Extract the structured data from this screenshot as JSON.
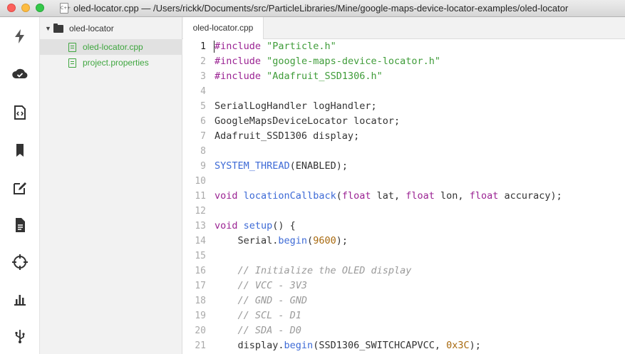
{
  "window": {
    "title": "oled-locator.cpp — /Users/rickk/Documents/src/ParticleLibraries/Mine/google-maps-device-locator-examples/oled-locator",
    "file_icon_text": "C++"
  },
  "activity_bar": [
    {
      "name": "flash",
      "icon": "lightning-icon"
    },
    {
      "name": "cloud",
      "icon": "cloud-check-icon"
    },
    {
      "name": "code",
      "icon": "code-file-icon"
    },
    {
      "name": "libraries",
      "icon": "bookmark-icon"
    },
    {
      "name": "edit",
      "icon": "edit-icon"
    },
    {
      "name": "docs",
      "icon": "document-icon"
    },
    {
      "name": "devices",
      "icon": "crosshair-icon"
    },
    {
      "name": "console",
      "icon": "bar-chart-icon"
    },
    {
      "name": "usb",
      "icon": "usb-icon"
    }
  ],
  "tree": {
    "root": "oled-locator",
    "files": [
      {
        "name": "oled-locator.cpp",
        "selected": true
      },
      {
        "name": "project.properties",
        "selected": false
      }
    ]
  },
  "tabs": [
    {
      "label": "oled-locator.cpp",
      "active": true
    }
  ],
  "editor": {
    "active_line": 1,
    "lines": [
      {
        "n": "1",
        "tokens": [
          [
            "kw",
            "#include"
          ],
          [
            "",
            " "
          ],
          [
            "str",
            "\"Particle.h\""
          ]
        ]
      },
      {
        "n": "2",
        "tokens": [
          [
            "kw",
            "#include"
          ],
          [
            "",
            " "
          ],
          [
            "str",
            "\"google-maps-device-locator.h\""
          ]
        ]
      },
      {
        "n": "3",
        "tokens": [
          [
            "kw",
            "#include"
          ],
          [
            "",
            " "
          ],
          [
            "str",
            "\"Adafruit_SSD1306.h\""
          ]
        ]
      },
      {
        "n": "4",
        "tokens": []
      },
      {
        "n": "5",
        "tokens": [
          [
            "",
            "SerialLogHandler logHandler;"
          ]
        ]
      },
      {
        "n": "6",
        "tokens": [
          [
            "",
            "GoogleMapsDeviceLocator locator;"
          ]
        ]
      },
      {
        "n": "7",
        "tokens": [
          [
            "",
            "Adafruit_SSD1306 display;"
          ]
        ]
      },
      {
        "n": "8",
        "tokens": []
      },
      {
        "n": "9",
        "tokens": [
          [
            "fn",
            "SYSTEM_THREAD"
          ],
          [
            "",
            "(ENABLED);"
          ]
        ]
      },
      {
        "n": "10",
        "tokens": []
      },
      {
        "n": "11",
        "tokens": [
          [
            "kw",
            "void"
          ],
          [
            "",
            " "
          ],
          [
            "fn",
            "locationCallback"
          ],
          [
            "",
            "("
          ],
          [
            "kw",
            "float"
          ],
          [
            "",
            " lat, "
          ],
          [
            "kw",
            "float"
          ],
          [
            "",
            " lon, "
          ],
          [
            "kw",
            "float"
          ],
          [
            "",
            " accuracy);"
          ]
        ]
      },
      {
        "n": "12",
        "tokens": []
      },
      {
        "n": "13",
        "tokens": [
          [
            "kw",
            "void"
          ],
          [
            "",
            " "
          ],
          [
            "fn",
            "setup"
          ],
          [
            "",
            "() {"
          ]
        ]
      },
      {
        "n": "14",
        "tokens": [
          [
            "",
            "    Serial."
          ],
          [
            "fn",
            "begin"
          ],
          [
            "",
            "("
          ],
          [
            "num",
            "9600"
          ],
          [
            "",
            ");"
          ]
        ]
      },
      {
        "n": "15",
        "tokens": []
      },
      {
        "n": "16",
        "tokens": [
          [
            "",
            "    "
          ],
          [
            "cmt",
            "// Initialize the OLED display"
          ]
        ]
      },
      {
        "n": "17",
        "tokens": [
          [
            "",
            "    "
          ],
          [
            "cmt",
            "// VCC - 3V3"
          ]
        ]
      },
      {
        "n": "18",
        "tokens": [
          [
            "",
            "    "
          ],
          [
            "cmt",
            "// GND - GND"
          ]
        ]
      },
      {
        "n": "19",
        "tokens": [
          [
            "",
            "    "
          ],
          [
            "cmt",
            "// SCL - D1"
          ]
        ]
      },
      {
        "n": "20",
        "tokens": [
          [
            "",
            "    "
          ],
          [
            "cmt",
            "// SDA - D0"
          ]
        ]
      },
      {
        "n": "21",
        "tokens": [
          [
            "",
            "    display."
          ],
          [
            "fn",
            "begin"
          ],
          [
            "",
            "(SSD1306_SWITCHCAPVCC, "
          ],
          [
            "num",
            "0x3C"
          ],
          [
            "",
            ");"
          ]
        ]
      }
    ]
  },
  "colors": {
    "keyword": "#9b2393",
    "string": "#3f9c39",
    "function": "#3d6ad6",
    "number": "#a8690e",
    "comment": "#9a9a9a",
    "file_green": "#3fa63f"
  }
}
